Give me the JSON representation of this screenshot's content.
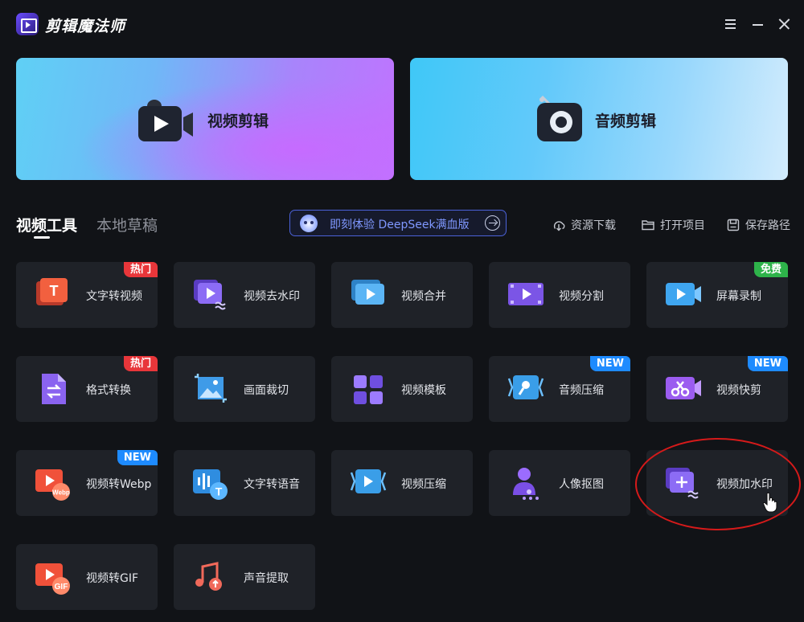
{
  "app": {
    "title": "剪辑魔法师"
  },
  "window_controls": {
    "menu": "menu-icon",
    "minimize": "minimize-icon",
    "close": "close-icon"
  },
  "hero": {
    "video_edit": {
      "label": "视频剪辑",
      "icon": "video-camera-icon"
    },
    "audio_edit": {
      "label": "音频剪辑",
      "icon": "audio-disc-icon"
    }
  },
  "tabs": {
    "tools": "视频工具",
    "drafts": "本地草稿"
  },
  "deepseek": {
    "text": "即刻体验 DeepSeek满血版"
  },
  "actions": {
    "download": "资源下载",
    "open_project": "打开项目",
    "save_path": "保存路径"
  },
  "badges": {
    "hot": "热门",
    "free": "免费",
    "new": "NEW"
  },
  "tools": [
    {
      "label": "文字转视频",
      "badge": "热门"
    },
    {
      "label": "视频去水印",
      "badge": ""
    },
    {
      "label": "视频合并",
      "badge": ""
    },
    {
      "label": "视频分割",
      "badge": ""
    },
    {
      "label": "屏幕录制",
      "badge": "免费"
    },
    {
      "label": "格式转换",
      "badge": "热门"
    },
    {
      "label": "画面裁切",
      "badge": ""
    },
    {
      "label": "视频模板",
      "badge": ""
    },
    {
      "label": "音频压缩",
      "badge": "NEW"
    },
    {
      "label": "视频快剪",
      "badge": "NEW"
    },
    {
      "label": "视频转Webp",
      "badge": "NEW"
    },
    {
      "label": "文字转语音",
      "badge": ""
    },
    {
      "label": "视频压缩",
      "badge": ""
    },
    {
      "label": "人像抠图",
      "badge": ""
    },
    {
      "label": "视频加水印",
      "badge": ""
    },
    {
      "label": "视频转GIF",
      "badge": ""
    },
    {
      "label": "声音提取",
      "badge": ""
    }
  ],
  "icon_texts": {
    "gif": "GIF",
    "webp": "Webp",
    "text_t": "T"
  },
  "colors": {
    "background": "#111317",
    "card": "#1f2228",
    "hot": "#e8363a",
    "free": "#2eb34a",
    "new": "#1e8bff",
    "accent": "#7f98ff",
    "highlight": "#d51a1a"
  }
}
